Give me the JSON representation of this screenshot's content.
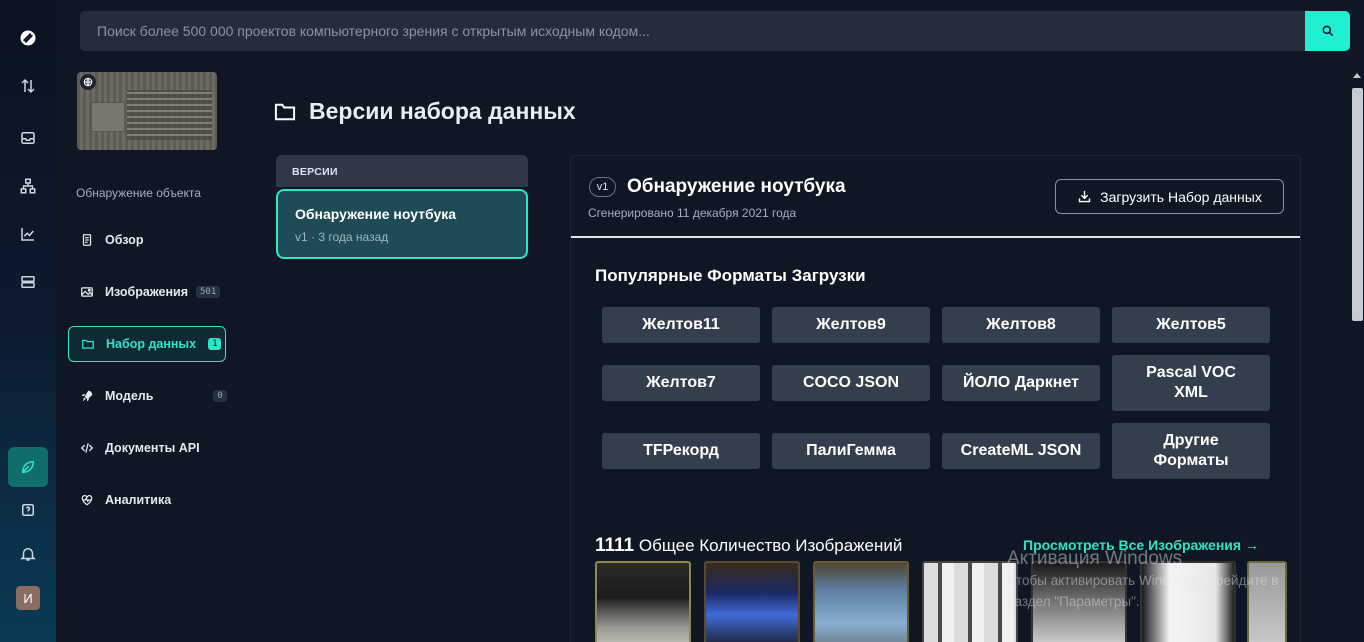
{
  "rail": {
    "icons": [
      "logo-icon",
      "swap-icon",
      "inbox-icon",
      "workflow-icon",
      "chart-icon",
      "storage-icon",
      "leaf-icon",
      "help-icon",
      "bell-icon"
    ],
    "avatar_letter": "И"
  },
  "search": {
    "placeholder": "Поиск более 500 000 проектов компьютерного зрения с открытым исходным кодом..."
  },
  "project": {
    "type": "Обнаружение объекта",
    "nav": [
      {
        "label": "Обзор",
        "icon": "document-icon"
      },
      {
        "label": "Изображения",
        "icon": "image-icon",
        "badge": "501"
      },
      {
        "label": "Набор данных",
        "icon": "folder-icon",
        "badge": "1",
        "active": true
      },
      {
        "label": "Модель",
        "icon": "rocket-icon",
        "badge": "0"
      },
      {
        "label": "Документы API",
        "icon": "code-icon"
      },
      {
        "label": "Аналитика",
        "icon": "heart-pulse-icon"
      }
    ]
  },
  "page": {
    "title": "Версии набора данных"
  },
  "versions": {
    "header": "ВЕРСИИ",
    "items": [
      {
        "name": "Обнаружение ноутбука",
        "version": "v1",
        "sep": "·",
        "age": "3 года назад"
      }
    ]
  },
  "dataset": {
    "version_badge": "v1",
    "title": "Обнаружение ноутбука",
    "generated": "Сгенерировано 11 декабря 2021 года",
    "download_label": "Загрузить Набор данных",
    "formats_title": "Популярные Форматы Загрузки",
    "formats": [
      "Желтов11",
      "Желтов9",
      "Желтов8",
      "Желтов5",
      "Желтов7",
      "COCO JSON",
      "ЙОЛО Даркнет",
      "Pascal VOC XML",
      "TFРекорд",
      "ПалиГемма",
      "CreateML JSON",
      "Другие Форматы"
    ],
    "image_count": "1111",
    "image_count_label": "Общее Количество Изображений",
    "view_all": "Просмотреть Все Изображения →"
  },
  "watermark": {
    "line1": "Активация Windows",
    "line2": "Чтобы активировать Windows, перейдите в",
    "line3": "раздел \"Параметры\"."
  },
  "colors": {
    "accent": "#2ee5c6",
    "background": "#0f1624",
    "button": "#353e4d"
  }
}
